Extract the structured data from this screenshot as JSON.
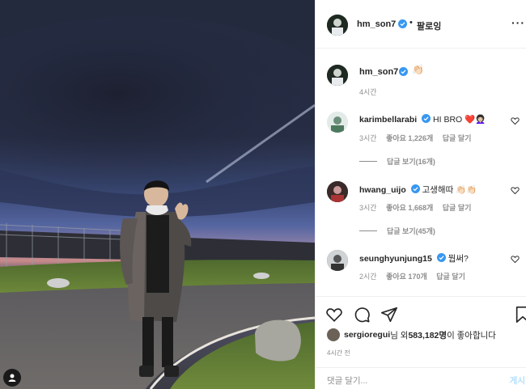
{
  "post": {
    "author": "hm_son7",
    "follow_label": "팔로잉",
    "more_label": "···",
    "caption_emoji": "👏🏻",
    "caption_time": "4시간",
    "verified_color": "#3897f0"
  },
  "comments": [
    {
      "user": "karimbellarabi",
      "text": "HI BRO ❤️👩🏻‍🦱",
      "time": "3시간",
      "likes": "좋아요 1,226개",
      "reply_label": "답글 달기",
      "view_replies": "답글 보기(16개)"
    },
    {
      "user": "hwang_uijo",
      "text": "고생해따 👏🏻👏🏻",
      "time": "3시간",
      "likes": "좋아요 1,668개",
      "reply_label": "답글 달기",
      "view_replies": "답글 보기(45개)"
    },
    {
      "user": "seunghyunjung15",
      "text": "뭡써?",
      "time": "2시간",
      "likes": "좋아요 170개",
      "reply_label": "답글 달기"
    }
  ],
  "likes": {
    "user": "sergioregui",
    "text_mid": "님 외 ",
    "count": "583,182명",
    "text_end": "이 좋아합니다"
  },
  "posted_ago": "4시간 전",
  "comment_box": {
    "placeholder": "댓글 달기...",
    "post_label": "게시"
  },
  "icons": {
    "like": "heart-icon",
    "comment": "comment-icon",
    "share": "share-icon",
    "save": "bookmark-icon",
    "tag": "user-tag-icon"
  }
}
